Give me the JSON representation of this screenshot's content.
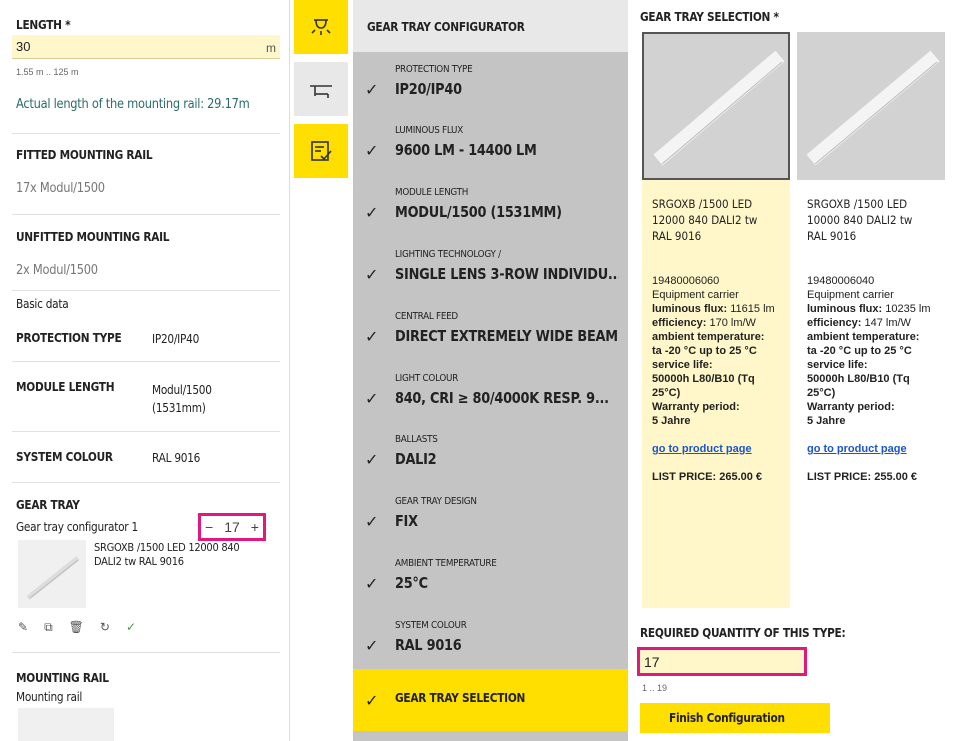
{
  "left": {
    "length_label": "LENGTH *",
    "length_value": "30",
    "length_unit": "m",
    "length_range": "1.55 m .. 125 m",
    "actual_length": "Actual length of the mounting rail: 29.17m",
    "fitted_label": "FITTED MOUNTING RAIL",
    "fitted_value": "17x Modul/1500",
    "unfitted_label": "UNFITTED MOUNTING RAIL",
    "unfitted_value": "2x Modul/1500",
    "basic_data": "Basic data",
    "props": [
      {
        "name": "PROTECTION TYPE",
        "value": "IP20/IP40"
      },
      {
        "name": "MODULE LENGTH",
        "value": "Modul/1500 (1531mm)"
      },
      {
        "name": "SYSTEM COLOUR",
        "value": "RAL 9016"
      }
    ],
    "gear_label": "GEAR TRAY",
    "gear_configurator": "Gear tray configurator 1",
    "gear_qty": "17",
    "minus": "−",
    "plus": "+",
    "gear_item": "SRGOXB /1500 LED 12000 840 DALI2 tw RAL 9016",
    "mount_label": "MOUNTING RAIL",
    "mount_sub": "Mounting rail"
  },
  "steps": {
    "title": "GEAR TRAY CONFIGURATOR",
    "items": [
      {
        "name": "PROTECTION TYPE",
        "value": "IP20/IP40"
      },
      {
        "name": "LUMINOUS FLUX",
        "value": "9600 LM - 14400 LM"
      },
      {
        "name": "MODULE LENGTH",
        "value": "MODUL/1500 (1531MM)"
      },
      {
        "name": "LIGHTING TECHNOLOGY /",
        "value": "SINGLE LENS 3-ROW INDIVIDU..."
      },
      {
        "name": "CENTRAL FEED",
        "value": "DIRECT EXTREMELY WIDE BEAM"
      },
      {
        "name": "LIGHT COLOUR",
        "value": "840, CRI ≥ 80/4000K RESP. 9..."
      },
      {
        "name": "BALLASTS",
        "value": "DALI2"
      },
      {
        "name": "GEAR TRAY DESIGN",
        "value": "FIX"
      },
      {
        "name": "AMBIENT TEMPERATURE",
        "value": "25°C"
      },
      {
        "name": "SYSTEM COLOUR",
        "value": "RAL 9016"
      }
    ],
    "final": "GEAR TRAY SELECTION"
  },
  "selection": {
    "title": "GEAR TRAY SELECTION *",
    "cards": [
      {
        "name": "SRGOXB /1500 LED 12000 840 DALI2 tw RAL 9016",
        "code": "19480006060",
        "type": "Equipment carrier",
        "flux_label": "luminous flux:",
        "flux": "11615 lm",
        "eff_label": "efficiency:",
        "eff": "170 lm/W",
        "amb_label": "ambient temperature:",
        "amb": "ta -20 °C up to 25 °C",
        "life_label": "service life:",
        "life": "50000h L80/B10 (Tq 25°C)",
        "warranty_label": "Warranty period:",
        "warranty": "5 Jahre",
        "link": "go to product page",
        "price": "LIST PRICE: 265.00 €"
      },
      {
        "name": "SRGOXB /1500 LED 10000 840 DALI2 tw RAL 9016",
        "code": "19480006040",
        "type": "Equipment carrier",
        "flux_label": "luminous flux:",
        "flux": "10235 lm",
        "eff_label": "efficiency:",
        "eff": "147 lm/W",
        "amb_label": "ambient temperature:",
        "amb": "ta -20 °C up to 25 °C",
        "life_label": "service life:",
        "life": "50000h L80/B10 (Tq 25°C)",
        "warranty_label": "Warranty period:",
        "warranty": "5 Jahre",
        "link": "go to product page",
        "price": "LIST PRICE: 255.00 €"
      }
    ],
    "req_label": "REQUIRED QUANTITY OF THIS TYPE:",
    "req_value": "17",
    "req_range": "1 .. 19",
    "finish": "Finish Configuration"
  },
  "colors": {
    "accent": "#ffdf00",
    "highlight": "#e3187f",
    "input_bg": "#fff7c9",
    "link": "#1a55cc"
  }
}
